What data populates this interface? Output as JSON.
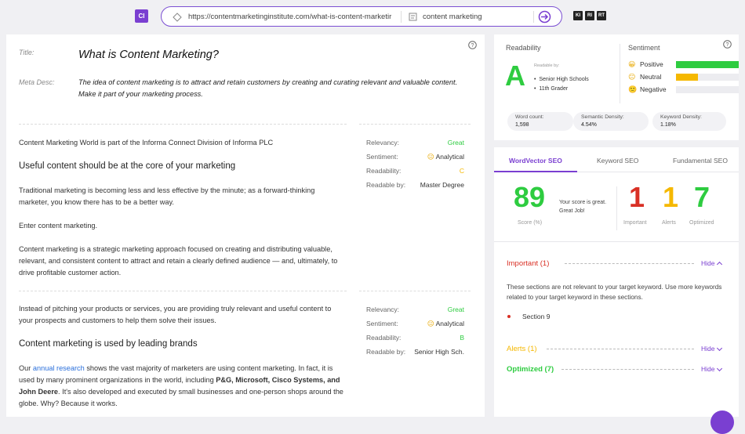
{
  "toolbar": {
    "logo": "CI",
    "url": "https://contentmarketinginstitute.com/what-is-content-marketir",
    "keyword": "content marketing",
    "btn1": "KI",
    "btn2": "RI",
    "btn3": "RT"
  },
  "article": {
    "title_label": "Title:",
    "title": "What is Content Marketing?",
    "meta_label": "Meta Desc:",
    "meta": "The idea of content marketing is to attract and retain customers by creating and curating relevant and valuable content. Make it part of your marketing process."
  },
  "sections": [
    {
      "intro": "Content Marketing World is part of the Informa Connect Division of Informa PLC",
      "heading": "Useful content should be at the core of your marketing",
      "p1": "Traditional marketing is becoming less and less effective by the minute; as a forward-thinking marketer, you know there has to be a better way.",
      "p2": "Enter content marketing.",
      "p3": "Content marketing is a strategic marketing approach focused on creating and distributing valuable, relevant, and consistent content to attract and retain a clearly defined audience — and, ultimately, to drive profitable customer action.",
      "relevancy_label": "Relevancy:",
      "relevancy": "Great",
      "sentiment_label": "Sentiment:",
      "sentiment": "Analytical",
      "readability_label": "Readability:",
      "readability": "C",
      "readable_by_label": "Readable by:",
      "readable_by": "Master Degree"
    },
    {
      "intro": "Instead of pitching your products or services, you are providing truly relevant and useful content to your prospects and customers to help them solve their issues.",
      "heading": "Content marketing is used by leading brands",
      "p_start": "Our ",
      "link": "annual research",
      "p_mid": " shows the vast majority of marketers are using content marketing. In fact, it is used by many prominent organizations in the world, including ",
      "p_bold": "P&G, Microsoft, Cisco Systems, and John Deere",
      "p_end": ". It's also developed and executed by small businesses and one-person shops around the globe. Why? Because it works.",
      "relevancy_label": "Relevancy:",
      "relevancy": "Great",
      "sentiment_label": "Sentiment:",
      "sentiment": "Analytical",
      "readability_label": "Readability:",
      "readability": "B",
      "readable_by_label": "Readable by:",
      "readable_by": "Senior High Sch."
    }
  ],
  "readability": {
    "title": "Readability",
    "grade": "A",
    "readable_by_label": "Readable by:",
    "readable_by": [
      "Senior High Schools",
      "11th Grader"
    ],
    "word_count_label": "Word count:",
    "word_count": "1,598",
    "semantic_label": "Semantic Density:",
    "semantic": "4.54%",
    "keyword_label": "Keyword Density:",
    "keyword": "1.18%"
  },
  "sentiment": {
    "title": "Sentiment",
    "rows": [
      {
        "label": "Positive",
        "level": 1.0,
        "color": "#2ecc40"
      },
      {
        "label": "Neutral",
        "level": 0.35,
        "color": "#f5b800"
      },
      {
        "label": "Negative",
        "level": 0.0,
        "color": "#e0e0e6"
      }
    ]
  },
  "tabs": [
    "WordVector SEO",
    "Keyword SEO",
    "Fundamental SEO"
  ],
  "score": {
    "value": "89",
    "label": "Score (%)",
    "message": "Your score is great. Great Job!",
    "important": "1",
    "important_label": "Important",
    "alerts": "1",
    "alerts_label": "Alerts",
    "optimized": "7",
    "optimized_label": "Optimized"
  },
  "groups": {
    "important_title": "Important (1)",
    "hide": "Hide",
    "important_desc": "These sections are not relevant to your target keyword. Use more keywords related to your target keyword in these sections.",
    "important_item": "Section 9",
    "alerts_title": "Alerts (1)",
    "optimized_title": "Optimized (7)"
  },
  "colors": {
    "accent": "#7a3fd1",
    "green": "#2ecc40",
    "red": "#d93025",
    "amber": "#f5b800",
    "grade_c": "#f5b800",
    "grade_b": "#2ecc40"
  }
}
